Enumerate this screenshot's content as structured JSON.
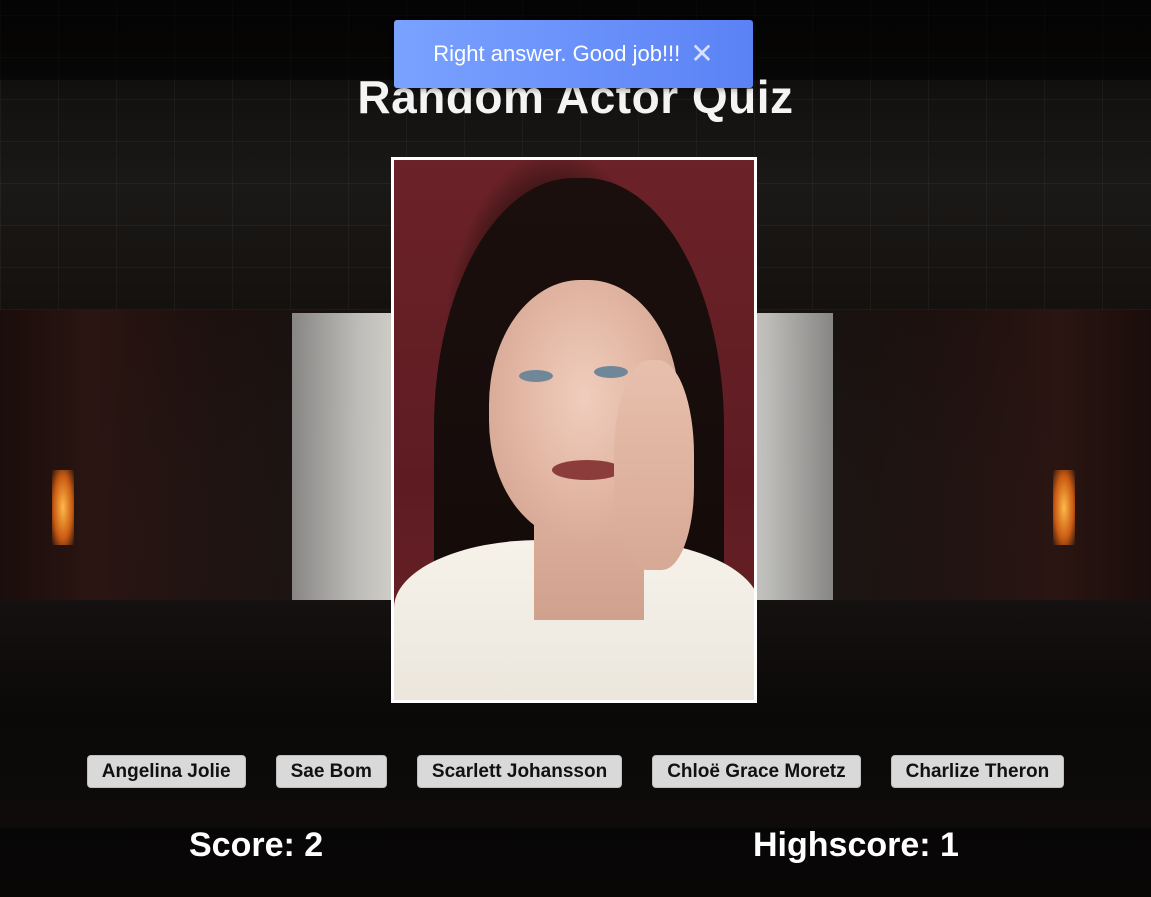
{
  "page": {
    "title": "Random Actor Quiz"
  },
  "toast": {
    "message": "Right answer. Good job!!!",
    "close_glyph": "✕",
    "color_start": "#7aa2ff",
    "color_end": "#5b82f5"
  },
  "question": {
    "image_icon": "actor-portrait-photo"
  },
  "options": [
    {
      "label": "Angelina Jolie"
    },
    {
      "label": "Sae Bom"
    },
    {
      "label": "Scarlett Johansson"
    },
    {
      "label": "Chloë Grace Moretz"
    },
    {
      "label": "Charlize Theron"
    }
  ],
  "stats": {
    "score": "Score: 2",
    "highscore": "Highscore: 1"
  }
}
